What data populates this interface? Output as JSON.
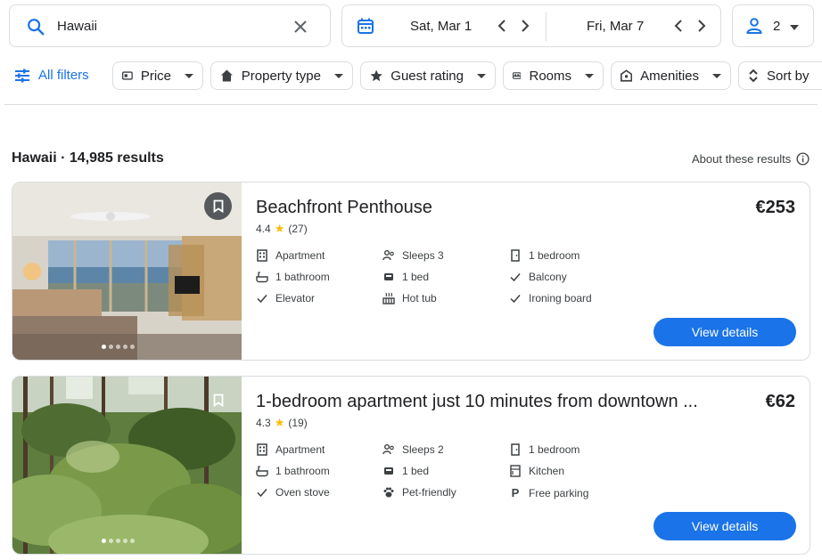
{
  "search": {
    "query": "Hawaii"
  },
  "dates": {
    "checkin": "Sat, Mar 1",
    "checkout": "Fri, Mar 7"
  },
  "guests": {
    "count": "2"
  },
  "filters": {
    "all_filters": "All filters",
    "chips": [
      "Price",
      "Property type",
      "Guest rating",
      "Rooms",
      "Amenities",
      "Sort by"
    ]
  },
  "results": {
    "title": "Hawaii · 14,985 results",
    "about": "About these results"
  },
  "listings": [
    {
      "name": "Beachfront Penthouse",
      "price": "€253",
      "rating": "4.4",
      "reviews": "(27)",
      "amenities": [
        [
          "Apartment",
          "Sleeps 3",
          "1 bedroom"
        ],
        [
          "1 bathroom",
          "1 bed",
          "Balcony"
        ],
        [
          "Elevator",
          "Hot tub",
          "Ironing board"
        ]
      ],
      "amenity_icons": [
        [
          "building-icon",
          "sleeps-icon",
          "door-icon"
        ],
        [
          "bathtub-icon",
          "bed-icon",
          "check-icon"
        ],
        [
          "check-icon",
          "hot-tub-icon",
          "check-icon"
        ]
      ],
      "button": "View details"
    },
    {
      "name": "1-bedroom apartment just 10 minutes from downtown ...",
      "price": "€62",
      "rating": "4.3",
      "reviews": "(19)",
      "amenities": [
        [
          "Apartment",
          "Sleeps 2",
          "1 bedroom"
        ],
        [
          "1 bathroom",
          "1 bed",
          "Kitchen"
        ],
        [
          "Oven stove",
          "Pet-friendly",
          "Free parking"
        ]
      ],
      "amenity_icons": [
        [
          "building-icon",
          "sleeps-icon",
          "door-icon"
        ],
        [
          "bathtub-icon",
          "bed-icon",
          "kitchen-icon"
        ],
        [
          "check-icon",
          "paw-icon",
          "parking-icon"
        ]
      ],
      "button": "View details"
    }
  ],
  "colors": {
    "accent": "#1a73e8",
    "star": "#fbbc04",
    "border": "#dadce0"
  }
}
